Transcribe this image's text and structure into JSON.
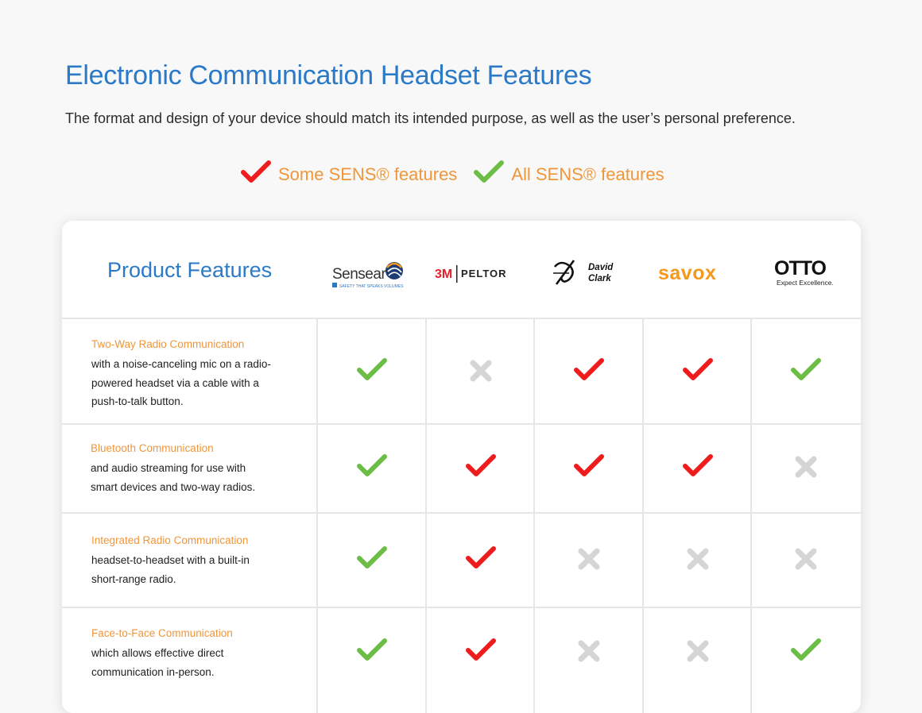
{
  "page": {
    "title": "Electronic Communication Headset Features",
    "subtitle": "The format and design of your device should match its intended purpose, as well as the user’s personal preference."
  },
  "legend": [
    {
      "mark": "check-red",
      "label": "Some SENS® features"
    },
    {
      "mark": "check-green",
      "label": "All SENS® features"
    }
  ],
  "table": {
    "header": "Product Features",
    "brands": [
      {
        "name": "Sensear",
        "tagline": "SAFETY THAT SPEAKS VOLUMES",
        "logo": "sensear-logo"
      },
      {
        "name": "PELTOR",
        "prefix": "3M",
        "logo": "3m-peltor-logo"
      },
      {
        "name_line1": "David",
        "name_line2": "Clark",
        "logo": "david-clark-logo"
      },
      {
        "name": "savox",
        "logo": "savox-logo"
      },
      {
        "name": "OTTO",
        "tagline": "Expect Excellence.",
        "logo": "otto-logo"
      }
    ],
    "rows": [
      {
        "name": "Two-Way Radio Communication",
        "desc": "with a noise-canceling mic on a radio-powered headset via a cable with a push-to-talk button.",
        "marks": [
          "check-green",
          "cross-gray",
          "check-red",
          "check-red",
          "check-green"
        ]
      },
      {
        "name": "Bluetooth Communication",
        "desc": "and audio streaming for use with smart devices and two-way radios.",
        "marks": [
          "check-green",
          "check-red",
          "check-red",
          "check-red",
          "cross-gray"
        ]
      },
      {
        "name": "Integrated Radio Communication",
        "desc": "headset-to-headset with a built-in short-range radio.",
        "marks": [
          "check-green",
          "check-red",
          "cross-gray",
          "cross-gray",
          "cross-gray"
        ]
      },
      {
        "name": "Face-to-Face Communication",
        "desc": "which allows effective direct communication in-person.",
        "marks": [
          "check-green",
          "check-red",
          "cross-gray",
          "cross-gray",
          "check-green"
        ]
      }
    ]
  },
  "colors": {
    "title_blue": "#2a7ac8",
    "accent_orange": "#f0963a",
    "check_green": "#6cbd45",
    "check_red": "#ee1c1c",
    "cross_gray": "#d5d5d5",
    "savox_orange": "#f39a1e"
  }
}
